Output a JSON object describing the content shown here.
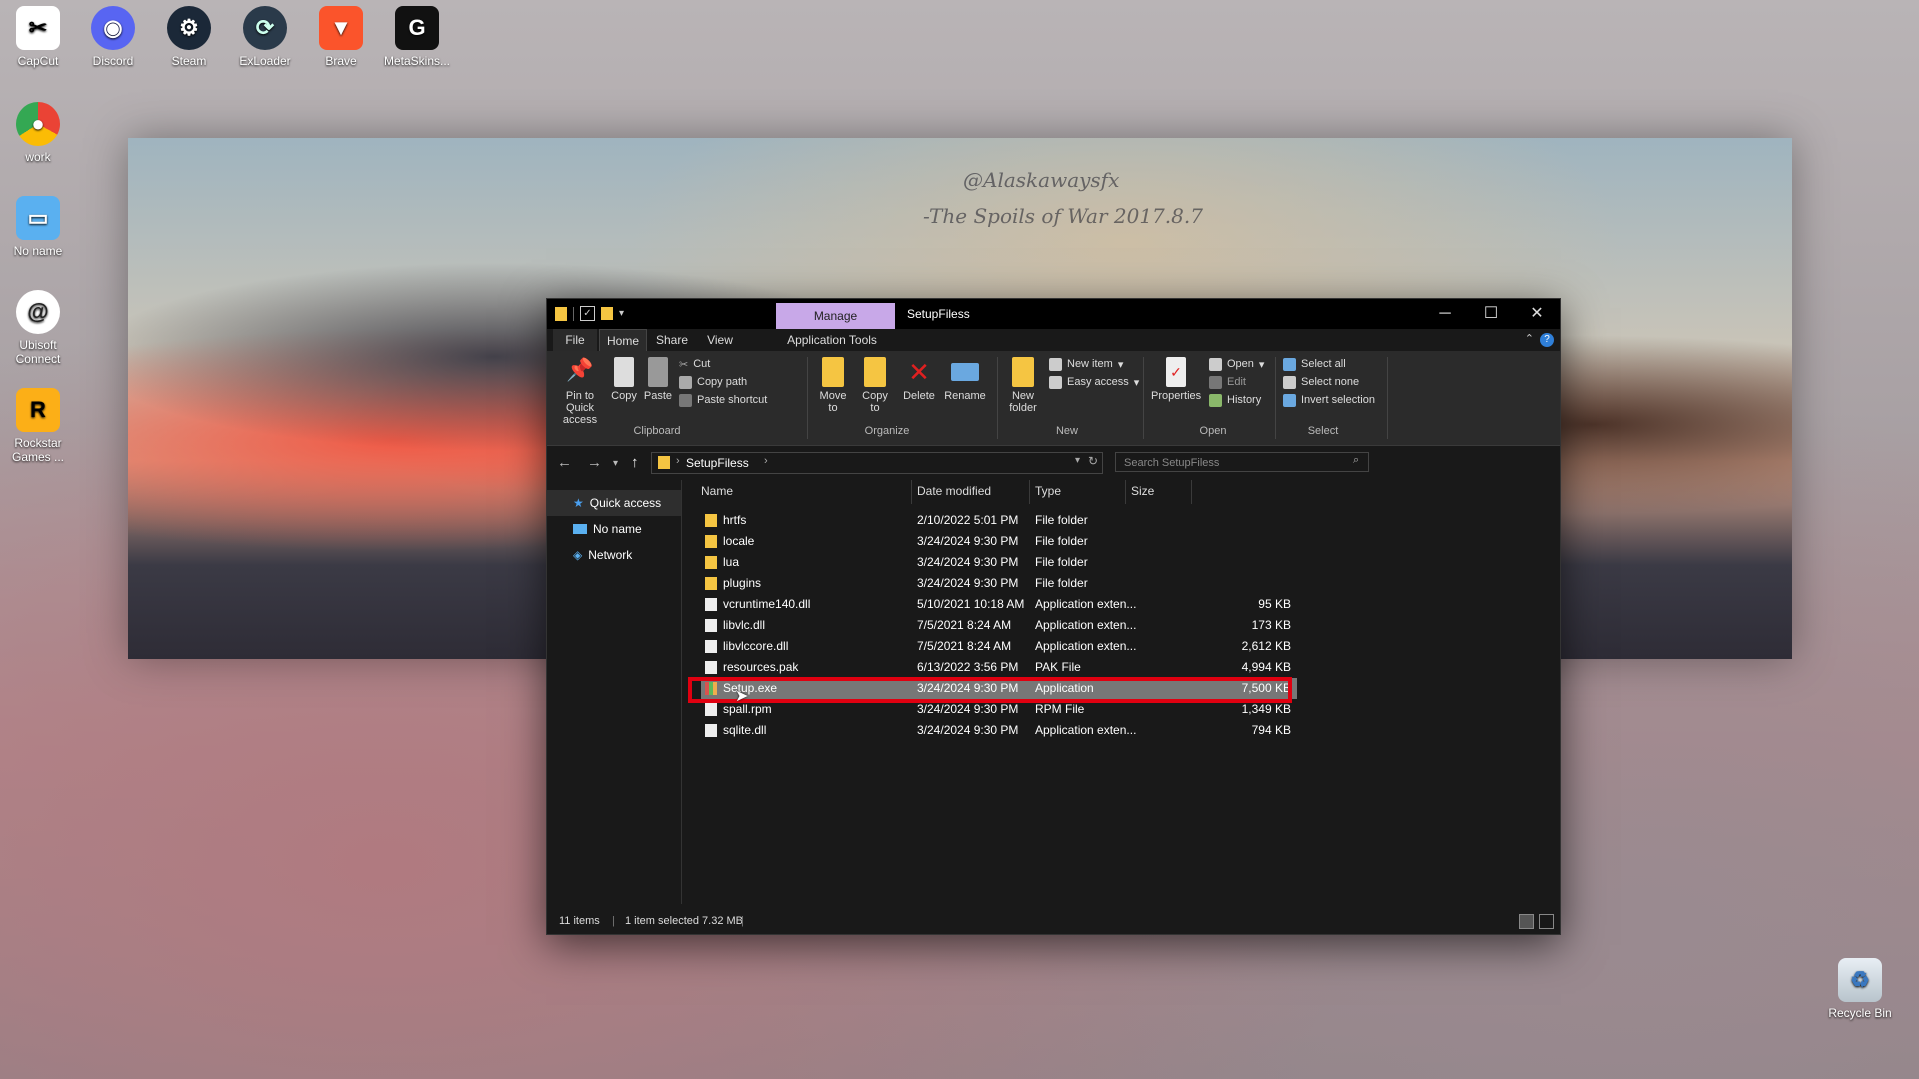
{
  "desktop_icons": [
    {
      "label": "CapCut",
      "icon": "capcut-icon"
    },
    {
      "label": "Discord",
      "icon": "discord-icon"
    },
    {
      "label": "Steam",
      "icon": "steam-icon"
    },
    {
      "label": "ExLoader",
      "icon": "exloader-icon"
    },
    {
      "label": "Brave",
      "icon": "brave-icon"
    },
    {
      "label": "MetaSkins...",
      "icon": "metaskins-icon"
    },
    {
      "label": "work",
      "icon": "chrome-icon"
    },
    {
      "label": "No name",
      "icon": "computer-icon"
    },
    {
      "label": "Ubisoft Connect",
      "icon": "ubisoft-icon"
    },
    {
      "label": "Rockstar Games ...",
      "icon": "rockstar-icon"
    },
    {
      "label": "Recycle Bin",
      "icon": "recycle-bin-icon"
    }
  ],
  "wallpaper": {
    "line1": "@Alaskawaysfx",
    "line2": "-The Spoils of War 2017.8.7"
  },
  "window": {
    "title": "SetupFiless",
    "manage_tab": "Manage",
    "tabs": [
      "File",
      "Home",
      "Share",
      "View",
      "Application Tools"
    ],
    "ribbon": {
      "clipboard": {
        "pin": "Pin to Quick access",
        "copy": "Copy",
        "paste": "Paste",
        "cut": "Cut",
        "copy_path": "Copy path",
        "paste_shortcut": "Paste shortcut",
        "group": "Clipboard"
      },
      "organize": {
        "move_to": "Move to",
        "copy_to": "Copy to",
        "delete": "Delete",
        "rename": "Rename",
        "group": "Organize"
      },
      "new": {
        "new_folder": "New folder",
        "new_item": "New item",
        "easy_access": "Easy access",
        "group": "New"
      },
      "open": {
        "properties": "Properties",
        "open": "Open",
        "edit": "Edit",
        "history": "History",
        "group": "Open"
      },
      "select": {
        "select_all": "Select all",
        "select_none": "Select none",
        "invert": "Invert selection",
        "group": "Select"
      }
    },
    "address": {
      "path": "SetupFiless",
      "search_placeholder": "Search SetupFiless"
    },
    "nav": [
      "Quick access",
      "No name",
      "Network"
    ],
    "columns": [
      "Name",
      "Date modified",
      "Type",
      "Size"
    ],
    "files": [
      {
        "name": "hrtfs",
        "date": "2/10/2022 5:01 PM",
        "type": "File folder",
        "size": "",
        "kind": "folder"
      },
      {
        "name": "locale",
        "date": "3/24/2024 9:30 PM",
        "type": "File folder",
        "size": "",
        "kind": "folder"
      },
      {
        "name": "lua",
        "date": "3/24/2024 9:30 PM",
        "type": "File folder",
        "size": "",
        "kind": "folder"
      },
      {
        "name": "plugins",
        "date": "3/24/2024 9:30 PM",
        "type": "File folder",
        "size": "",
        "kind": "folder"
      },
      {
        "name": "vcruntime140.dll",
        "date": "5/10/2021 10:18 AM",
        "type": "Application exten...",
        "size": "95 KB",
        "kind": "file"
      },
      {
        "name": "libvlc.dll",
        "date": "7/5/2021 8:24 AM",
        "type": "Application exten...",
        "size": "173 KB",
        "kind": "file"
      },
      {
        "name": "libvlccore.dll",
        "date": "7/5/2021 8:24 AM",
        "type": "Application exten...",
        "size": "2,612 KB",
        "kind": "file"
      },
      {
        "name": "resources.pak",
        "date": "6/13/2022 3:56 PM",
        "type": "PAK File",
        "size": "4,994 KB",
        "kind": "file"
      },
      {
        "name": "Setup.exe",
        "date": "3/24/2024 9:30 PM",
        "type": "Application",
        "size": "7,500 KB",
        "kind": "exe",
        "selected": true
      },
      {
        "name": "spall.rpm",
        "date": "3/24/2024 9:30 PM",
        "type": "RPM File",
        "size": "1,349 KB",
        "kind": "file"
      },
      {
        "name": "sqlite.dll",
        "date": "3/24/2024 9:30 PM",
        "type": "Application exten...",
        "size": "794 KB",
        "kind": "file"
      }
    ],
    "status": {
      "items": "11 items",
      "selected": "1 item selected  7.32 MB"
    }
  },
  "colors": {
    "highlight": "#e00010",
    "manage": "#c8a8e8",
    "folder": "#f5c542"
  }
}
